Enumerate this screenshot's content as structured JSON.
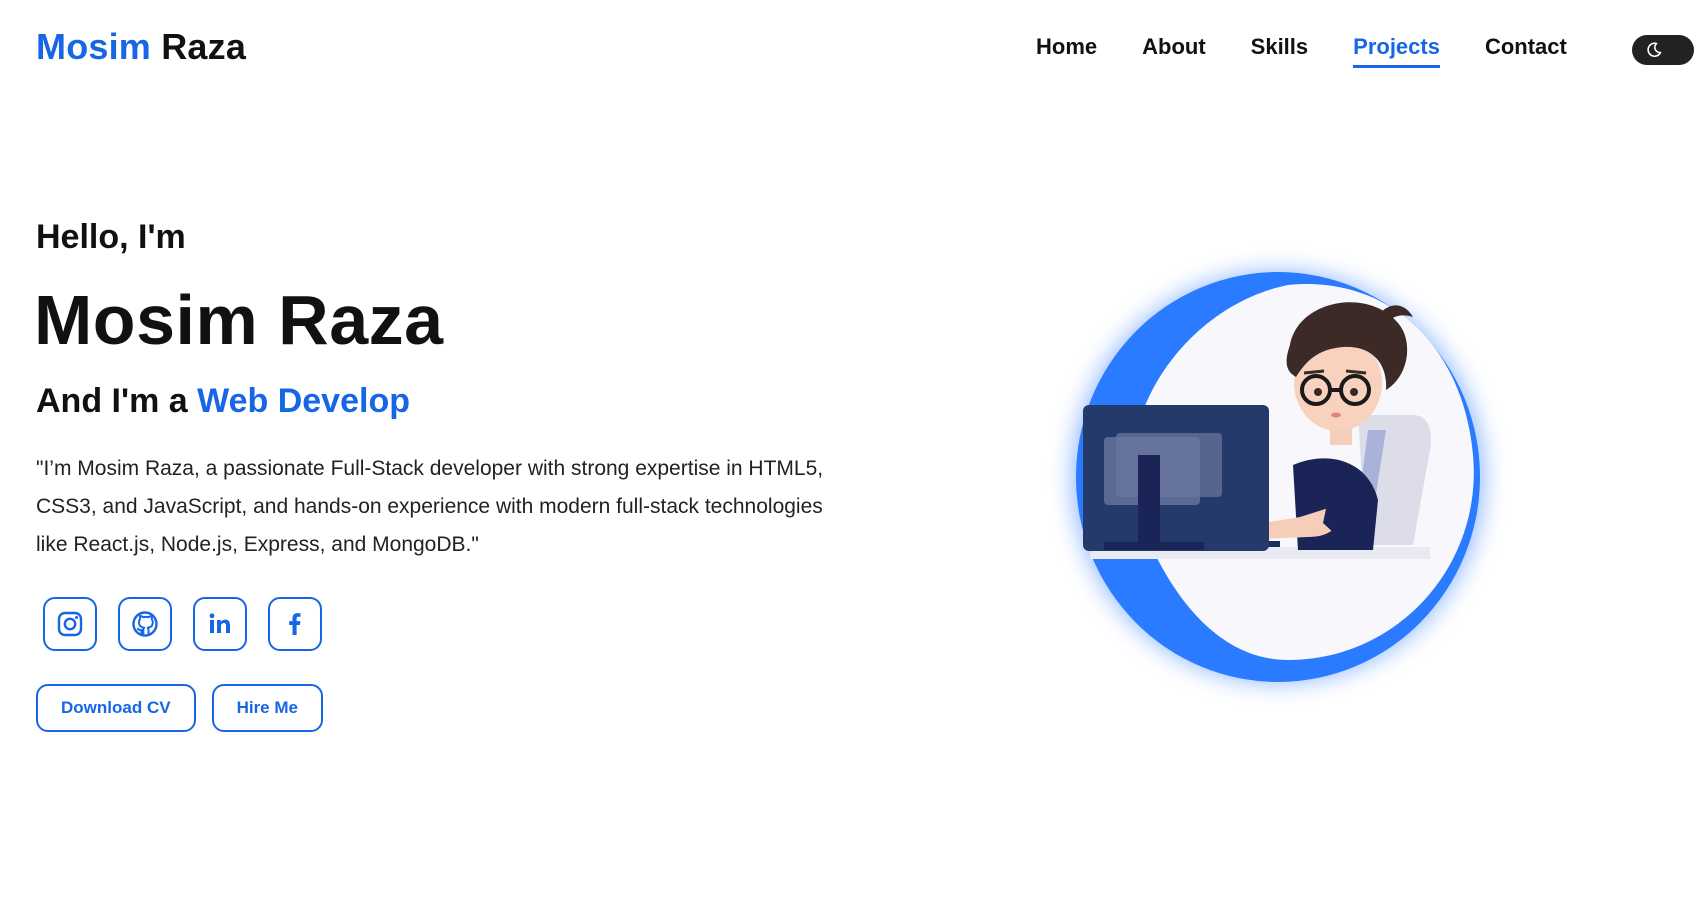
{
  "header": {
    "logo_first": "Mosim",
    "logo_last": "Raza",
    "nav": [
      {
        "label": "Home"
      },
      {
        "label": "About"
      },
      {
        "label": "Skills"
      },
      {
        "label": "Projects",
        "active": true
      },
      {
        "label": "Contact"
      }
    ],
    "theme_toggle_icon": "moon-icon"
  },
  "hero": {
    "greeting": "Hello, I'm",
    "name": "Mosim Raza",
    "role_prefix": "And I'm a ",
    "role_typed": "Web Develop",
    "bio": "\"I’m Mosim Raza, a passionate Full-Stack developer with strong expertise in HTML5, CSS3, and JavaScript, and hands-on experience with modern full-stack technologies like React.js, Node.js, Express, and MongoDB.\"",
    "socials": [
      {
        "icon": "instagram-icon"
      },
      {
        "icon": "github-icon"
      },
      {
        "icon": "linkedin-icon"
      },
      {
        "icon": "facebook-icon"
      }
    ],
    "buttons": {
      "download_cv": "Download CV",
      "hire_me": "Hire Me"
    },
    "illustration": "developer-at-computer-avatar"
  },
  "colors": {
    "accent": "#1766e6",
    "text": "#111111",
    "background": "#ffffff"
  }
}
